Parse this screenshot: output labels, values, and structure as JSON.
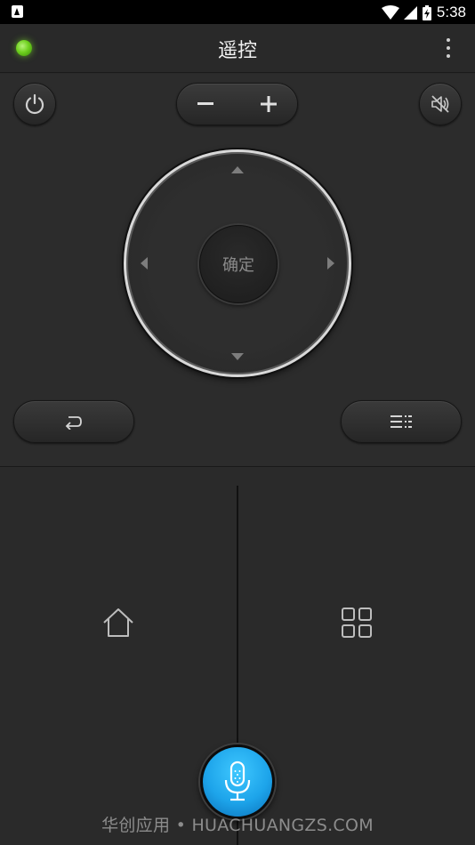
{
  "status_bar": {
    "time": "5:38",
    "icons": [
      "notification-a-icon",
      "wifi-icon",
      "signal-icon",
      "battery-charging-icon"
    ]
  },
  "header": {
    "title": "遥控",
    "connection_led_color": "#6fd11f",
    "menu_icon": "more-vertical-icon"
  },
  "controls": {
    "power_icon": "power-icon",
    "volume_down_label": "−",
    "volume_up_label": "+",
    "mute_icon": "volume-mute-icon",
    "ok_label": "确定",
    "back_icon": "back-icon",
    "menu_icon": "menu-list-icon"
  },
  "bottom": {
    "home_icon": "home-icon",
    "apps_icon": "grid-icon",
    "voice_icon": "microphone-icon",
    "voice_color": "#1da4ea"
  },
  "watermark": "华创应用 • HUACHUANGZS.COM"
}
